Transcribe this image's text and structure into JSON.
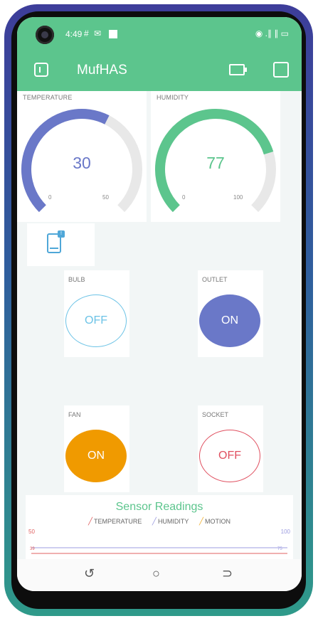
{
  "status_bar": {
    "time": "4:49",
    "left_icons": "# ✉",
    "right_icons": "◉ .∥ ∥ ▭"
  },
  "app": {
    "title": "MufHAS"
  },
  "gauges": [
    {
      "label": "TEMPERATURE",
      "value": "30",
      "min": "0",
      "max": "50",
      "value_fraction": 0.6,
      "color": "#6a78c8"
    },
    {
      "label": "HUMIDITY",
      "value": "77",
      "min": "0",
      "max": "100",
      "value_fraction": 0.77,
      "color": "#5cc58d"
    }
  ],
  "device_badge": "!",
  "buttons": {
    "bulb": {
      "label": "BULB",
      "state": "OFF",
      "color": "#6cc3e6"
    },
    "outlet": {
      "label": "OUTLET",
      "state": "ON",
      "color": "#6a78c8"
    },
    "fan": {
      "label": "FAN",
      "state": "ON",
      "color": "#f09a00"
    },
    "socket": {
      "label": "SOCKET",
      "state": "OFF",
      "color": "#e05060"
    }
  },
  "chart": {
    "title": "Sensor Readings",
    "legend": [
      "TEMPERATURE",
      "HUMIDITY",
      "MOTION"
    ],
    "y_left_max": "50",
    "y_right_max": "100",
    "left_marker": "39",
    "right_marker": "75"
  },
  "colors": {
    "accent": "#5cc58d",
    "temperature": "#e06060",
    "humidity": "#9c9ce0",
    "motion": "#f0b030"
  }
}
